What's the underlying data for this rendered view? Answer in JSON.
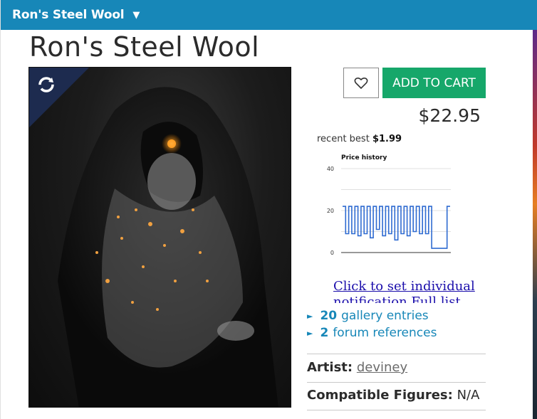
{
  "window": {
    "title": "Ron's Steel Wool"
  },
  "product": {
    "title": "Ron's Steel Wool",
    "price": "$22.95",
    "recent_best_label": "recent best",
    "recent_best_value": "$1.99",
    "add_to_cart_label": "ADD TO CART",
    "notify_link": "Click to set individual notification",
    "full_list_link": "Full list",
    "gallery_count": "20",
    "gallery_label": "gallery entries",
    "forum_count": "2",
    "forum_label": "forum references",
    "artist_key": "Artist:",
    "artist_value": "deviney",
    "compat_key": "Compatible Figures:",
    "compat_value": "N/A"
  },
  "chart_data": {
    "type": "line",
    "title": "Price history",
    "yticks": [
      "40",
      "20",
      "0"
    ],
    "ylim": [
      0,
      40
    ],
    "grid": true,
    "series": [
      {
        "values": [
          22,
          9,
          22,
          9,
          22,
          8,
          22,
          9,
          22,
          7,
          22,
          11,
          22,
          8,
          22,
          9,
          22,
          6,
          22,
          9,
          22,
          8,
          22,
          10,
          22,
          9,
          22,
          9,
          22,
          2,
          2,
          2,
          2,
          2,
          22,
          22
        ]
      }
    ]
  },
  "colors": {
    "accent": "#1787b8",
    "cart": "#16a76a",
    "line": "#2f6bd1"
  },
  "icons": {
    "favorite": "heart-icon",
    "badge": "sync-icon",
    "dropdown": "caret-down-icon",
    "expand": "triangle-right-icon"
  }
}
